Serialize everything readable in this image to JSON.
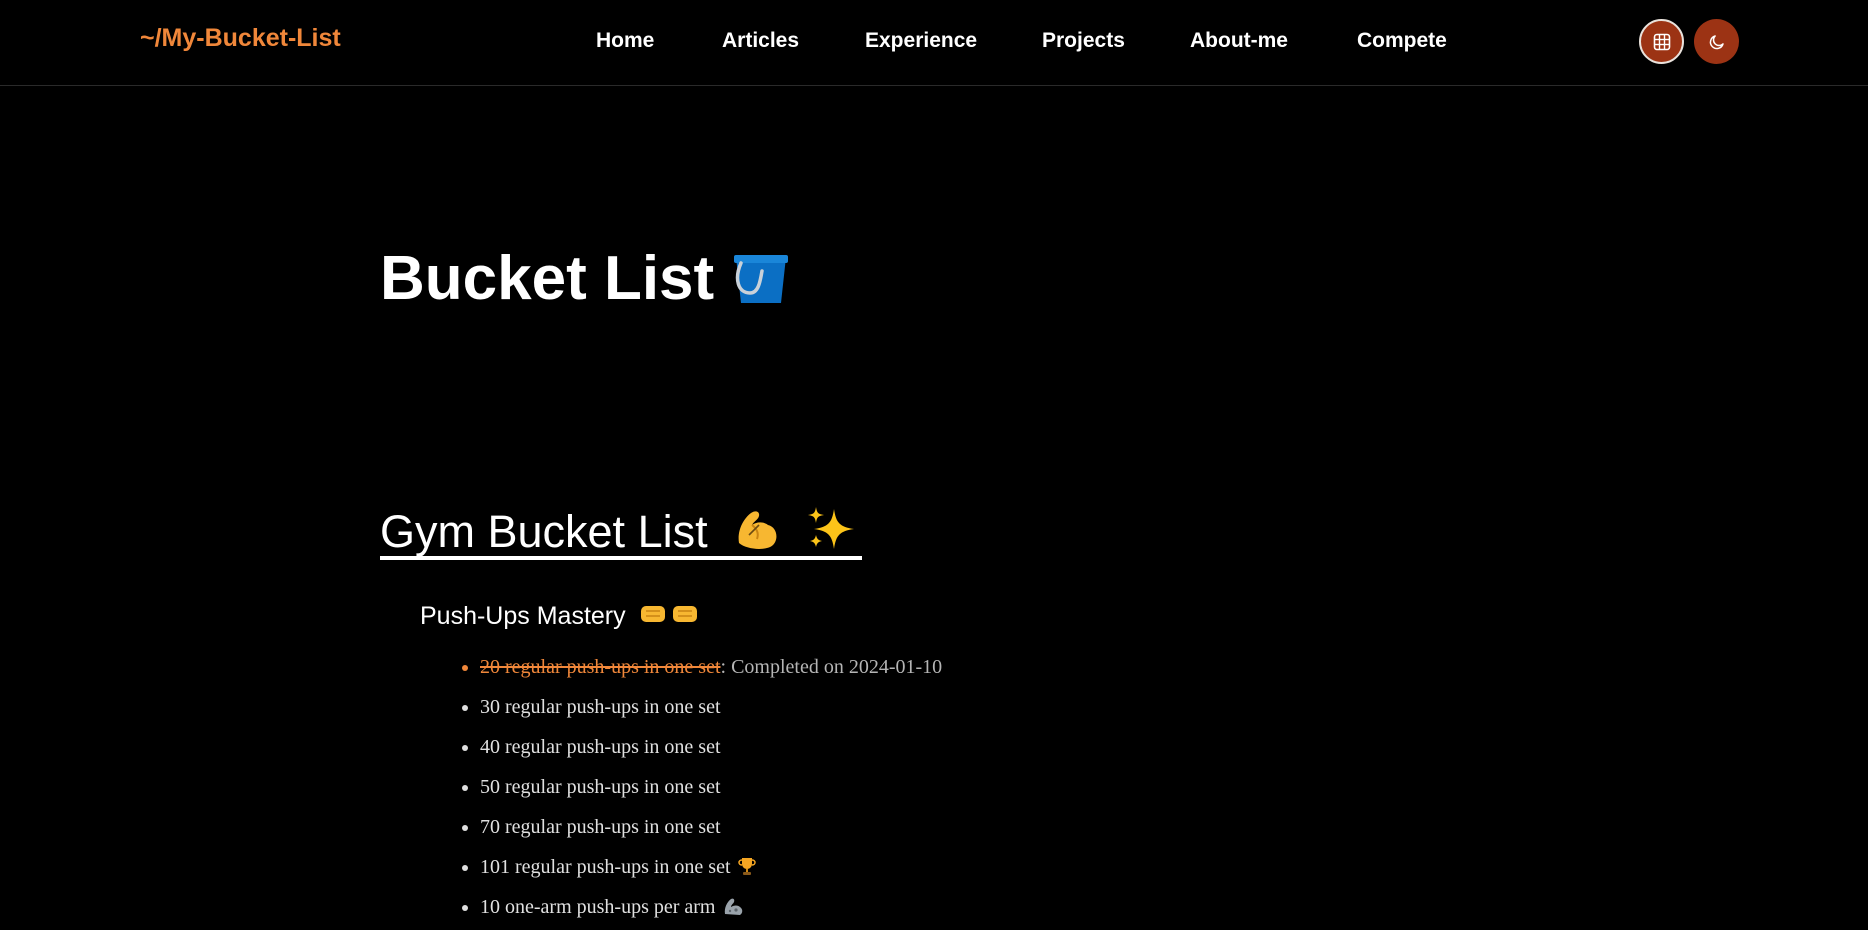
{
  "nav": {
    "logo": "~/My-Bucket-List",
    "links": [
      "Home",
      "Articles",
      "Experience",
      "Projects",
      "About-me",
      "Compete"
    ]
  },
  "icons": {
    "grid_button": "grid-icon",
    "theme_button": "moon-icon",
    "title_emoji": "bucket-icon",
    "section_emojis": [
      "flexed-biceps-icon",
      "sparkles-icon"
    ],
    "subsection_emojis": [
      "right-facing-fist-icon",
      "right-facing-fist-icon"
    ],
    "trophy": "trophy-icon",
    "mechanical_arm": "mechanical-arm-icon"
  },
  "colors": {
    "background": "#000000",
    "accent": "#f0873a",
    "button": "#9c3314",
    "text": "#ffffff",
    "muted": "#b5b5b5"
  },
  "page": {
    "title": "Bucket List"
  },
  "section": {
    "title": "Gym Bucket List",
    "subsection": {
      "title": "Push-Ups Mastery",
      "goals": [
        {
          "text": "20 regular push-ups in one set",
          "completed": true,
          "note": ": Completed on 2024-01-10"
        },
        {
          "text": "30 regular push-ups in one set",
          "completed": false
        },
        {
          "text": "40 regular push-ups in one set",
          "completed": false
        },
        {
          "text": "50 regular push-ups in one set",
          "completed": false
        },
        {
          "text": "70 regular push-ups in one set",
          "completed": false
        },
        {
          "text": "101 regular push-ups in one set",
          "completed": false,
          "emoji": "trophy-icon"
        },
        {
          "text": "10 one-arm push-ups per arm",
          "completed": false,
          "emoji": "mechanical-arm-icon"
        }
      ]
    }
  }
}
